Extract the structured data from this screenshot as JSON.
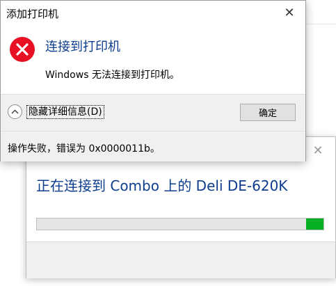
{
  "error_dialog": {
    "title": "添加打印机",
    "close_icon": "close-icon",
    "status_icon": "error-icon",
    "status_icon_color": "#e81123",
    "main_instruction": "连接到打印机",
    "content": "Windows 无法连接到打印机。",
    "details_toggle_label": "隐藏详细信息(D)",
    "ok_label": "确定",
    "details_text": "操作失败，错误为 0x0000011b。"
  },
  "progress_dialog": {
    "close_icon": "close-icon",
    "heading": "正在连接到 Combo 上的 Deli DE-620K",
    "progress_color": "#06b025",
    "progress_marquee_start": 0.94,
    "progress_marquee_end": 1.0
  }
}
